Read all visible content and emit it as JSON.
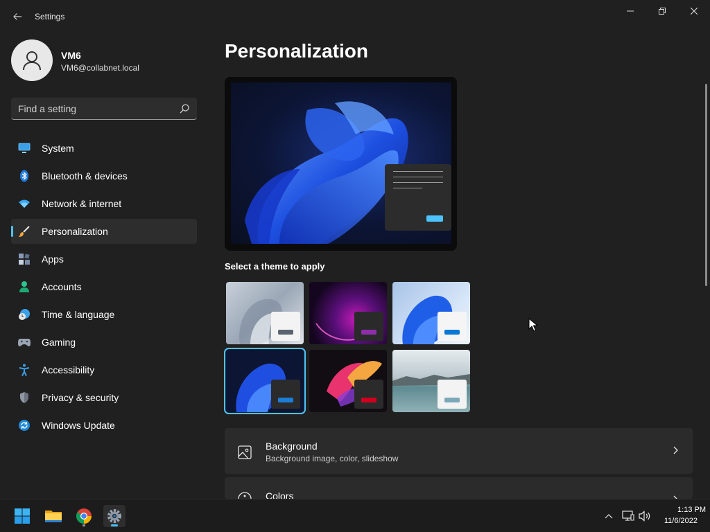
{
  "window": {
    "title": "Settings"
  },
  "profile": {
    "name": "VM6",
    "email": "VM6@collabnet.local"
  },
  "search": {
    "placeholder": "Find a setting"
  },
  "nav": {
    "items": [
      {
        "label": "System",
        "icon": "monitor-icon"
      },
      {
        "label": "Bluetooth & devices",
        "icon": "bluetooth-icon"
      },
      {
        "label": "Network & internet",
        "icon": "wifi-icon"
      },
      {
        "label": "Personalization",
        "icon": "brush-icon",
        "selected": true
      },
      {
        "label": "Apps",
        "icon": "apps-icon"
      },
      {
        "label": "Accounts",
        "icon": "person-icon"
      },
      {
        "label": "Time & language",
        "icon": "clock-globe-icon"
      },
      {
        "label": "Gaming",
        "icon": "gamepad-icon"
      },
      {
        "label": "Accessibility",
        "icon": "accessibility-icon"
      },
      {
        "label": "Privacy & security",
        "icon": "shield-icon"
      },
      {
        "label": "Windows Update",
        "icon": "update-icon"
      }
    ]
  },
  "main": {
    "title": "Personalization",
    "themes_heading": "Select a theme to apply",
    "themes": [
      {
        "name": "theme-light-glow",
        "selected": false
      },
      {
        "name": "theme-purple-flow",
        "selected": false
      },
      {
        "name": "theme-windows-light",
        "selected": false
      },
      {
        "name": "theme-windows-dark",
        "selected": true
      },
      {
        "name": "theme-captured-motion",
        "selected": false
      },
      {
        "name": "theme-sunrise-lake",
        "selected": false
      }
    ],
    "cards": [
      {
        "title": "Background",
        "subtitle": "Background image, color, slideshow",
        "icon": "image-icon"
      },
      {
        "title": "Colors",
        "subtitle": "",
        "icon": "palette-icon"
      }
    ]
  },
  "taskbar": {
    "apps": [
      "start-icon",
      "file-explorer-icon",
      "chrome-icon",
      "settings-icon"
    ],
    "time": "1:13 PM",
    "date": "11/6/2022"
  },
  "colors": {
    "accent": "#4cc2ff",
    "background": "#202020",
    "card": "#2b2b2b"
  }
}
